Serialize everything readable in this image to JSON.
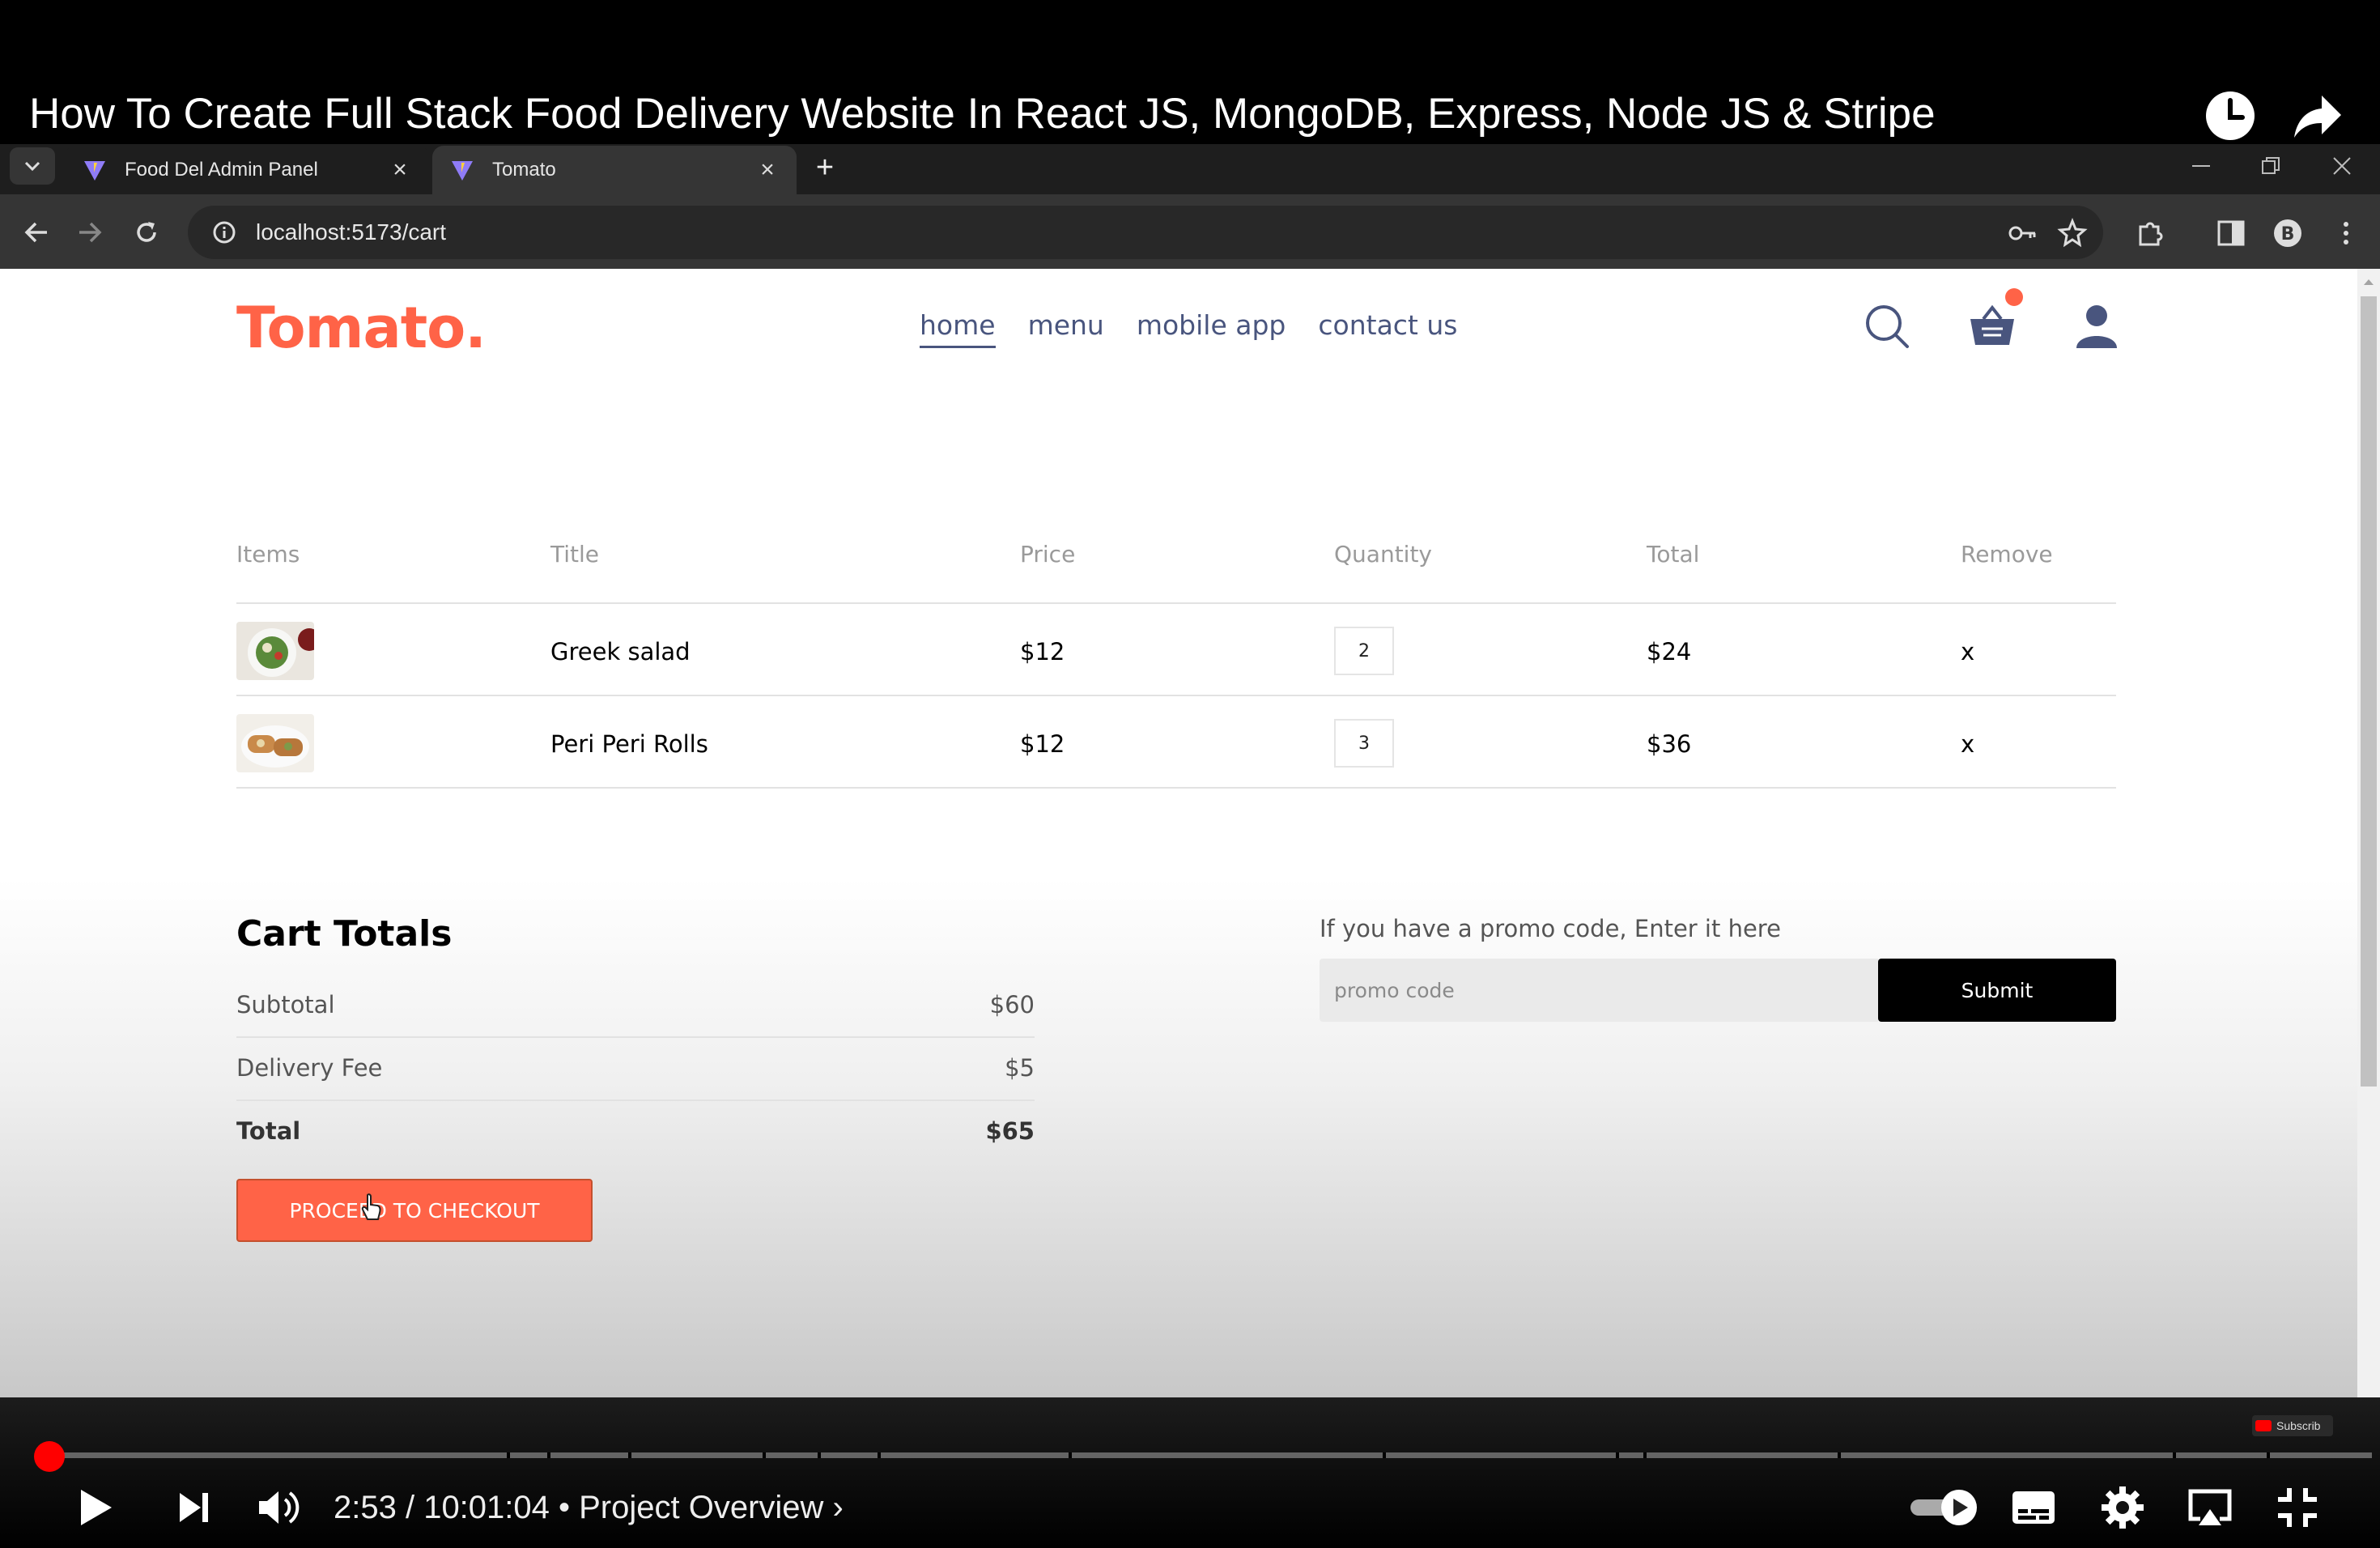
{
  "video": {
    "title": "How To Create Full Stack Food Delivery Website In React JS, MongoDB, Express, Node JS & Stripe",
    "time_display": "2:53 / 10:01:04 • Project Overview ›",
    "progress_fraction": 0.0048,
    "subscribe_badge": "Subscrib"
  },
  "browser": {
    "tabs": [
      {
        "label": "Food Del Admin Panel",
        "active": false
      },
      {
        "label": "Tomato",
        "active": true
      }
    ],
    "url": "localhost:5173/cart"
  },
  "site": {
    "logo": "Tomato.",
    "nav": [
      "home",
      "menu",
      "mobile app",
      "contact us"
    ],
    "active_nav": "home",
    "accent_color": "#ff6347"
  },
  "cart": {
    "headers": [
      "Items",
      "Title",
      "Price",
      "Quantity",
      "Total",
      "Remove"
    ],
    "rows": [
      {
        "title": "Greek salad",
        "price": "$12",
        "quantity": "2",
        "total": "$24",
        "remove": "x"
      },
      {
        "title": "Peri Peri Rolls",
        "price": "$12",
        "quantity": "3",
        "total": "$36",
        "remove": "x"
      }
    ]
  },
  "totals": {
    "heading": "Cart Totals",
    "subtotal_label": "Subtotal",
    "subtotal": "$60",
    "delivery_label": "Delivery Fee",
    "delivery": "$5",
    "total_label": "Total",
    "total": "$65",
    "checkout_label": "PROCEED TO CHECKOUT"
  },
  "promo": {
    "label": "If you have a promo code, Enter it here",
    "placeholder": "promo code",
    "submit_label": "Submit"
  }
}
